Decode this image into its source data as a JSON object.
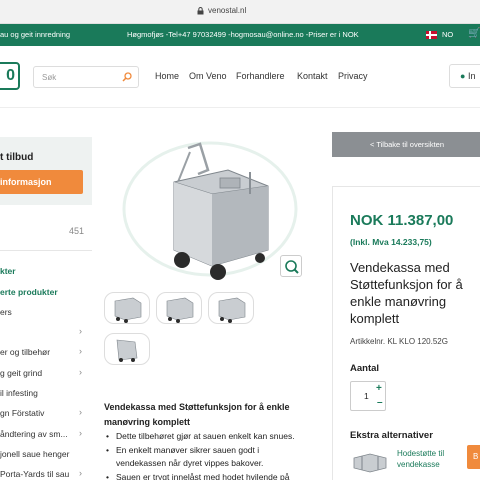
{
  "browser": {
    "url": "venostal.nl"
  },
  "topbar": {
    "left_text": "au og geit innredning",
    "contact_text": "Høgmofjøs -Tel+47 97032499 -hogmosau@online.no -Priser er i NOK",
    "language": "NO"
  },
  "header": {
    "logo_text": "0",
    "search_placeholder": "Søk",
    "nav": [
      "Home",
      "Om Veno",
      "Forhandlere",
      "Kontakt",
      "Privacy"
    ],
    "login_label": "In"
  },
  "sidebar": {
    "title": "t tilbud",
    "info_button": "r informasjon",
    "count": "451",
    "items": [
      {
        "label": "kter",
        "style": "green",
        "arrow": false
      },
      {
        "label": "erte produkter",
        "style": "green",
        "arrow": false
      },
      {
        "label": "ers",
        "style": "normal",
        "arrow": false
      },
      {
        "label": "",
        "style": "normal",
        "arrow": true
      },
      {
        "label": "er og tilbehør",
        "style": "normal",
        "arrow": true
      },
      {
        "label": "g geit grind",
        "style": "normal",
        "arrow": true
      },
      {
        "label": "il infesting",
        "style": "normal",
        "arrow": false
      },
      {
        "label": "gn Förstativ",
        "style": "normal",
        "arrow": true
      },
      {
        "label": "åndtering av sm...",
        "style": "normal",
        "arrow": true
      },
      {
        "label": "jonell saue henger",
        "style": "normal",
        "arrow": false
      },
      {
        "label": "Porta-Yards til sau",
        "style": "normal",
        "arrow": true
      }
    ]
  },
  "product": {
    "back_button": "< Tilbake til oversikten",
    "price": "NOK 11.387,00",
    "price_inkl": "(Inkl. Mva 14.233,75)",
    "title": "Vendekassa med Støttefunksjon for å enkle manøvring komplett",
    "article_no": "Artikkelnr. KL KLO 120.52G",
    "quantity_label": "Aantal",
    "quantity_value": "1",
    "extra_title": "Ekstra alternativer",
    "extra_item": "Hodestøtte til vendekasse",
    "extra_button": "B",
    "description_title": "Vendekassa med Støttefunksjon for å enkle manøvring komplett",
    "bullets": [
      "Dette tilbehøret gjør at sauen enkelt kan snues.",
      "En enkelt manøver sikrer sauen godt i vendekassen når dyret vippes bakover.",
      "Sauen er trygt innelåst med hodet hvilende på"
    ]
  },
  "colors": {
    "brand_green": "#1a7a5a",
    "accent_orange": "#f08a3c",
    "back_gray": "#8b8f93"
  }
}
